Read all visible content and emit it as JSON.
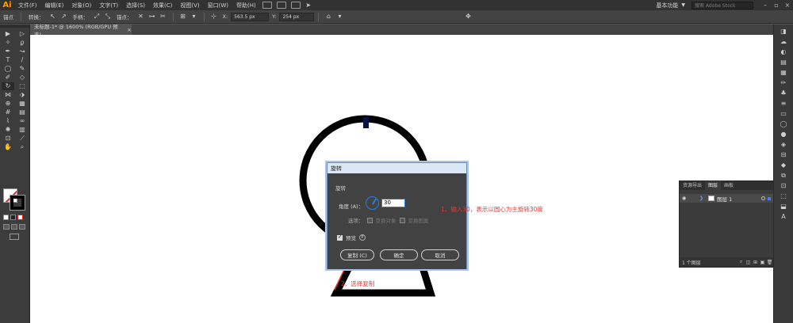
{
  "menubar": {
    "logo": "Ai",
    "items": [
      "文件(F)",
      "编辑(E)",
      "对象(O)",
      "文字(T)",
      "选择(S)",
      "效果(C)",
      "视图(V)",
      "窗口(W)",
      "帮助(H)"
    ],
    "workspace": "基本功能",
    "search_placeholder": "搜索 Adobe Stock"
  },
  "controlbar": {
    "anchor_label": "锚点",
    "convert_label": "转换：",
    "handles_label": "手柄：",
    "anchors_label": "锚点：",
    "x_value": "563.5 px",
    "y_value": "254 px"
  },
  "tab": {
    "title": "未标题-1* @ 1600% (RGB/GPU 预览)",
    "close": "×"
  },
  "dialog": {
    "title": "旋转",
    "section": "旋转",
    "angle_label": "角度 (A)：",
    "angle_value": "30",
    "options_label": "选项：",
    "option_objects": "变换对象",
    "option_patterns": "变换图案",
    "preview_label": "预览",
    "preview_hotkey": "P",
    "copy_button": "复制 (C)",
    "ok_button": "确定",
    "cancel_button": "取消"
  },
  "annotations": {
    "step1": "1、输入30，表示以圆心为主旋转30度",
    "step2": "2、选择复制"
  },
  "layers_panel": {
    "tabs": [
      "资源导出",
      "图层",
      "画板"
    ],
    "layer_name": "图层 1",
    "count": "1 个图层"
  },
  "colors": {
    "accent": "#2f7fd6",
    "annotation": "#e33333",
    "dialog_title_bg": "#dbe7f4"
  }
}
